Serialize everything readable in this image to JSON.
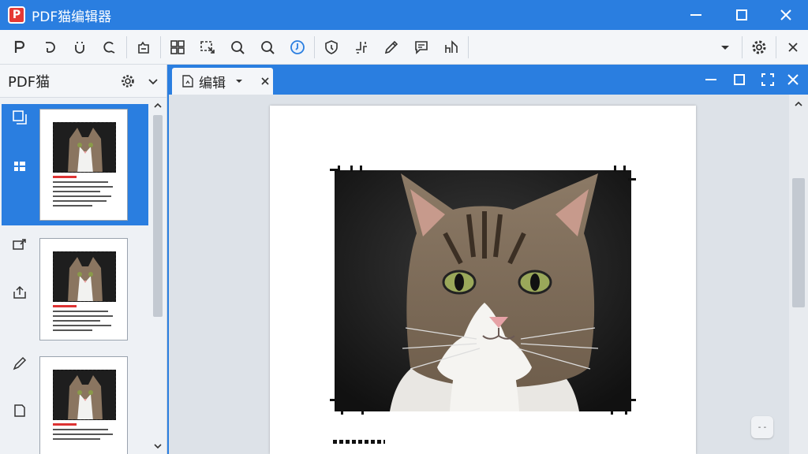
{
  "app": {
    "title": "PDF猫编辑器",
    "logo_letter": "P",
    "accent": "#2a7ee0",
    "logo_color": "#e53935"
  },
  "window_controls": [
    "minimize-icon",
    "maximize-icon",
    "close-icon"
  ],
  "toolbar": {
    "groups": [
      [
        "text-tool-icon",
        "rotate-icon",
        "undo-icon",
        "redo-icon"
      ],
      [
        "export-icon"
      ],
      [
        "thumbnails-grid-icon",
        "select-region-icon",
        "zoom-out-icon",
        "zoom-in-icon",
        "clock-icon"
      ],
      [
        "shield-icon",
        "crop-icon",
        "pen-icon",
        "comment-icon",
        "sign-icon"
      ]
    ],
    "right": [
      "chevron-down-icon",
      "gear-icon",
      "close-icon"
    ]
  },
  "sidebar": {
    "title": "PDF猫",
    "pages": [
      {
        "selected": true,
        "icon": "layers-icon",
        "icon2": "list-icon"
      },
      {
        "selected": false,
        "icon": "annotation-icon",
        "icon2": "upload-icon"
      },
      {
        "selected": false,
        "icon": "brush-icon",
        "icon2": "page-icon"
      }
    ]
  },
  "document": {
    "tab_label": "编辑",
    "float_label": "- -"
  }
}
